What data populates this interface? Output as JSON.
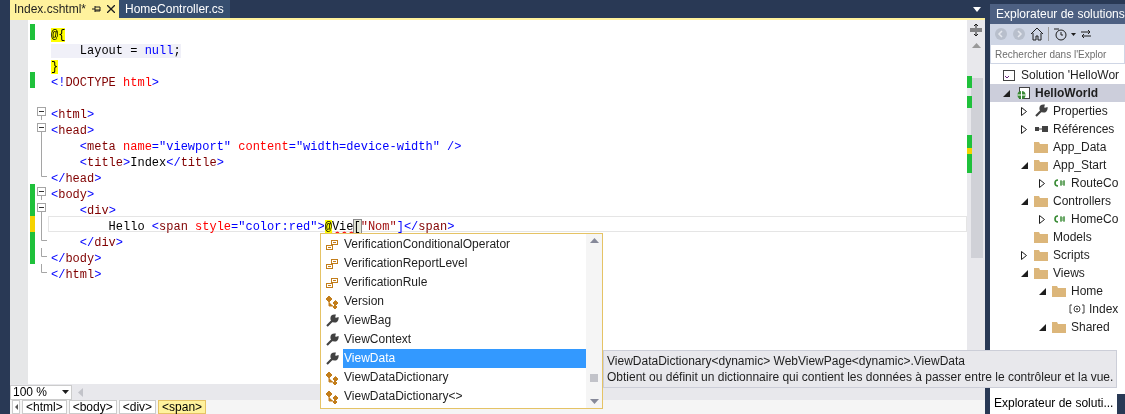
{
  "tabs": [
    {
      "label": "Index.cshtml*",
      "selected": true
    },
    {
      "label": "HomeController.cs",
      "selected": false
    }
  ],
  "code_lines": [
    {
      "changed": true,
      "saved": true,
      "tokens": [
        {
          "kind": "razor",
          "text": "@{"
        }
      ]
    },
    {
      "tokens": [
        {
          "kind": "code",
          "text": "    Layout = "
        },
        {
          "kind": "code-keyword",
          "text": "null"
        },
        {
          "kind": "code",
          "text": ";"
        }
      ]
    },
    {
      "tokens": [
        {
          "kind": "razor",
          "text": "}"
        }
      ]
    },
    {
      "changed": true,
      "saved": true,
      "tokens": [
        {
          "kind": "delim",
          "text": "<!"
        },
        {
          "kind": "tag",
          "text": "DOCTYPE"
        },
        {
          "kind": "attr",
          "text": " html"
        },
        {
          "kind": "delim",
          "text": ">"
        }
      ]
    },
    {
      "blank_before": true,
      "fold_start": true,
      "tokens": [
        {
          "kind": "delim",
          "text": "<"
        },
        {
          "kind": "tag",
          "text": "html"
        },
        {
          "kind": "delim",
          "text": ">"
        }
      ]
    },
    {
      "fold_start": true,
      "tokens": [
        {
          "kind": "delim",
          "text": "<"
        },
        {
          "kind": "tag",
          "text": "head"
        },
        {
          "kind": "delim",
          "text": ">"
        }
      ]
    },
    {
      "tokens": [
        {
          "kind": "delim",
          "text": "    <"
        },
        {
          "kind": "tag",
          "text": "meta"
        },
        {
          "kind": "attr",
          "text": " name"
        },
        {
          "kind": "delim",
          "text": "="
        },
        {
          "kind": "value",
          "text": "\"viewport\""
        },
        {
          "kind": "attr",
          "text": " content"
        },
        {
          "kind": "delim",
          "text": "="
        },
        {
          "kind": "value",
          "text": "\"width=device-width\""
        },
        {
          "kind": "delim",
          "text": " />"
        }
      ]
    },
    {
      "tokens": [
        {
          "kind": "delim",
          "text": "    <"
        },
        {
          "kind": "tag",
          "text": "title"
        },
        {
          "kind": "delim",
          "text": ">"
        },
        {
          "kind": "plain",
          "text": "Index"
        },
        {
          "kind": "delim",
          "text": "</"
        },
        {
          "kind": "tag",
          "text": "title"
        },
        {
          "kind": "delim",
          "text": ">"
        }
      ]
    },
    {
      "fold_end": true,
      "tokens": [
        {
          "kind": "delim",
          "text": "</"
        },
        {
          "kind": "tag",
          "text": "head"
        },
        {
          "kind": "delim",
          "text": ">"
        }
      ]
    },
    {
      "changed": true,
      "saved": true,
      "fold_start": true,
      "tokens": [
        {
          "kind": "delim",
          "text": "<"
        },
        {
          "kind": "tag",
          "text": "body"
        },
        {
          "kind": "delim",
          "text": ">"
        }
      ]
    },
    {
      "changed": true,
      "saved": true,
      "fold_start": true,
      "tokens": [
        {
          "kind": "delim",
          "text": "    <"
        },
        {
          "kind": "tag",
          "text": "div"
        },
        {
          "kind": "delim",
          "text": ">"
        }
      ]
    },
    {
      "changed": true,
      "saved": false,
      "current": true,
      "tokens": [
        {
          "kind": "plain",
          "text": "        Hello"
        },
        {
          "kind": "delim",
          "text": " <"
        },
        {
          "kind": "tag",
          "text": "span"
        },
        {
          "kind": "attr",
          "text": " style"
        },
        {
          "kind": "delim",
          "text": "="
        },
        {
          "kind": "value",
          "text": "\"color:red\""
        },
        {
          "kind": "delim",
          "text": ">"
        },
        {
          "kind": "razor",
          "text": "@"
        },
        {
          "kind": "error",
          "text": "Vie"
        },
        {
          "kind": "matched",
          "text": "["
        },
        {
          "kind": "string",
          "text": "\"Nom\""
        },
        {
          "kind": "delim",
          "text": "]"
        },
        {
          "kind": "delim",
          "text": "</"
        },
        {
          "kind": "tag",
          "text": "span"
        },
        {
          "kind": "delim",
          "text": ">"
        }
      ]
    },
    {
      "changed": true,
      "saved": true,
      "fold_end": true,
      "tokens": [
        {
          "kind": "delim",
          "text": "    </"
        },
        {
          "kind": "tag",
          "text": "div"
        },
        {
          "kind": "delim",
          "text": ">"
        }
      ]
    },
    {
      "changed": true,
      "saved": true,
      "fold_end": true,
      "tokens": [
        {
          "kind": "delim",
          "text": "</"
        },
        {
          "kind": "tag",
          "text": "body"
        },
        {
          "kind": "delim",
          "text": ">"
        }
      ]
    },
    {
      "fold_end": true,
      "tokens": [
        {
          "kind": "delim",
          "text": "</"
        },
        {
          "kind": "tag",
          "text": "html"
        },
        {
          "kind": "delim",
          "text": ">"
        }
      ]
    }
  ],
  "completion": [
    {
      "label": "VerificationConditionalOperator",
      "kind": "enum",
      "selected": false
    },
    {
      "label": "VerificationReportLevel",
      "kind": "enum",
      "selected": false
    },
    {
      "label": "VerificationRule",
      "kind": "enum",
      "selected": false
    },
    {
      "label": "Version",
      "kind": "class",
      "selected": false
    },
    {
      "label": "ViewBag",
      "kind": "property",
      "selected": false
    },
    {
      "label": "ViewContext",
      "kind": "property",
      "selected": false
    },
    {
      "label": "ViewData",
      "kind": "property",
      "selected": true
    },
    {
      "label": "ViewDataDictionary",
      "kind": "class",
      "selected": false
    },
    {
      "label": "ViewDataDictionary<>",
      "kind": "class",
      "selected": false
    }
  ],
  "tooltip": {
    "signature": "ViewDataDictionary<dynamic> WebViewPage<dynamic>.ViewData",
    "description": "Obtient ou définit un dictionnaire qui contient les données à passer entre le contrôleur et la vue."
  },
  "zoom": "100 %",
  "breadcrumbs": [
    {
      "label": "<html>",
      "selected": false
    },
    {
      "label": "<body>",
      "selected": false
    },
    {
      "label": "<div>",
      "selected": false
    },
    {
      "label": "<span>",
      "selected": true
    }
  ],
  "solution_explorer": {
    "title": "Explorateur de solutions",
    "search": {
      "placeholder": "Rechercher dans l'Explor"
    },
    "tree": [
      {
        "label": "Solution 'HelloWor",
        "kind": "solution",
        "selected": false,
        "bold": false,
        "children": [
          {
            "label": "HelloWorld",
            "kind": "web-project",
            "selected": true,
            "bold": true,
            "expanded": true,
            "children": [
              {
                "label": "Properties",
                "kind": "wrench",
                "selected": false,
                "bold": false,
                "expanded": false
              },
              {
                "label": "Références",
                "kind": "references",
                "selected": false,
                "bold": false,
                "expanded": false
              },
              {
                "label": "App_Data",
                "kind": "folder",
                "selected": false,
                "bold": false
              },
              {
                "label": "App_Start",
                "kind": "folder",
                "selected": false,
                "bold": false,
                "expanded": true,
                "children": [
                  {
                    "label": "RouteCo",
                    "kind": "csharp",
                    "selected": false,
                    "bold": false,
                    "expanded": false
                  }
                ]
              },
              {
                "label": "Controllers",
                "kind": "folder",
                "selected": false,
                "bold": false,
                "expanded": true,
                "children": [
                  {
                    "label": "HomeCo",
                    "kind": "csharp",
                    "selected": false,
                    "bold": false,
                    "expanded": false
                  }
                ]
              },
              {
                "label": "Models",
                "kind": "folder",
                "selected": false,
                "bold": false
              },
              {
                "label": "Scripts",
                "kind": "folder",
                "selected": false,
                "bold": false,
                "expanded": false
              },
              {
                "label": "Views",
                "kind": "folder",
                "selected": false,
                "bold": false,
                "expanded": true,
                "children": [
                  {
                    "label": "Home",
                    "kind": "folder",
                    "selected": false,
                    "bold": false,
                    "expanded": true,
                    "children": [
                      {
                        "label": "Index",
                        "kind": "razor-file",
                        "selected": false,
                        "bold": false
                      }
                    ]
                  },
                  {
                    "label": "Shared",
                    "kind": "folder",
                    "selected": false,
                    "bold": false,
                    "expanded": true
                  }
                ]
              }
            ]
          }
        ]
      }
    ],
    "bottom_tab": "Explorateur de soluti..."
  }
}
